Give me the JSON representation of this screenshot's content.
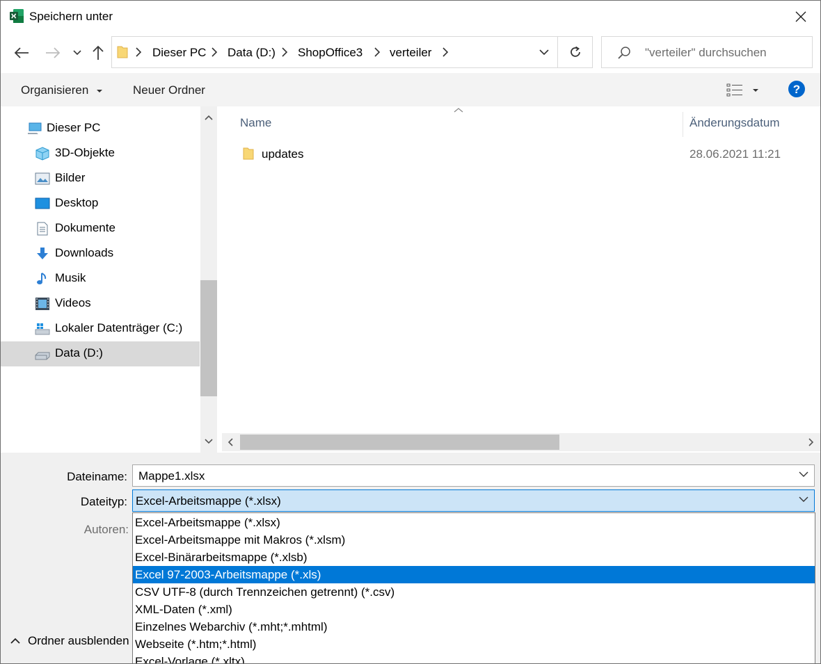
{
  "window": {
    "title": "Speichern unter"
  },
  "address": {
    "crumbs": [
      "Dieser PC",
      "Data (D:)",
      "ShopOffice3",
      "verteiler"
    ],
    "search_placeholder": "\"verteiler\" durchsuchen"
  },
  "toolbar": {
    "organize": "Organisieren",
    "new_folder": "Neuer Ordner"
  },
  "nav": {
    "items": [
      {
        "label": "Dieser PC",
        "icon": "pc-icon"
      },
      {
        "label": "3D-Objekte",
        "icon": "cube-icon"
      },
      {
        "label": "Bilder",
        "icon": "pictures-icon"
      },
      {
        "label": "Desktop",
        "icon": "desktop-icon"
      },
      {
        "label": "Dokumente",
        "icon": "documents-icon"
      },
      {
        "label": "Downloads",
        "icon": "download-arrow-icon"
      },
      {
        "label": "Musik",
        "icon": "music-note-icon"
      },
      {
        "label": "Videos",
        "icon": "film-icon"
      },
      {
        "label": "Lokaler Datenträger (C:)",
        "icon": "windows-drive-icon"
      },
      {
        "label": "Data (D:)",
        "icon": "drive-icon"
      }
    ]
  },
  "files": {
    "columns": {
      "name": "Name",
      "date": "Änderungsdatum"
    },
    "rows": [
      {
        "name": "updates",
        "date": "28.06.2021 11:21"
      }
    ]
  },
  "form": {
    "filename_label": "Dateiname:",
    "filename_value": "Mappe1.xlsx",
    "filetype_label": "Dateityp:",
    "filetype_value": "Excel-Arbeitsmappe (*.xlsx)",
    "authors_label": "Autoren:",
    "hide_folders": "Ordner ausblenden"
  },
  "filetype_options": [
    "Excel-Arbeitsmappe (*.xlsx)",
    "Excel-Arbeitsmappe mit Makros (*.xlsm)",
    "Excel-Binärarbeitsmappe (*.xlsb)",
    "Excel 97-2003-Arbeitsmappe (*.xls)",
    "CSV UTF-8 (durch Trennzeichen getrennt) (*.csv)",
    "XML-Daten (*.xml)",
    "Einzelnes Webarchiv (*.mht;*.mhtml)",
    "Webseite (*.htm;*.html)",
    "Excel-Vorlage (*.xltx)"
  ],
  "colors": {
    "accent": "#0078d7",
    "selected_bg": "#d9d9d9",
    "header_text": "#4c607a",
    "folder": "#f8d775"
  }
}
